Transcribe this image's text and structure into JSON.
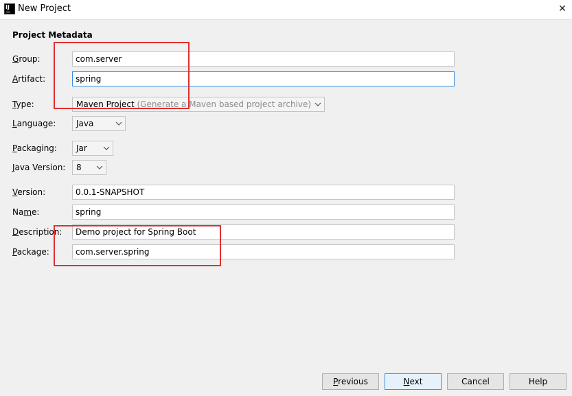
{
  "window": {
    "title": "New Project",
    "close_glyph": "✕"
  },
  "section": {
    "title": "Project Metadata"
  },
  "fields": {
    "group": {
      "mnemonic": "G",
      "rest": "roup:",
      "value": "com.server"
    },
    "artifact": {
      "mnemonic": "A",
      "rest": "rtifact:",
      "value": "spring"
    },
    "type": {
      "mnemonic": "T",
      "rest": "ype:",
      "value": "Maven Project",
      "hint": "(Generate a Maven based project archive)"
    },
    "language": {
      "mnemonic": "L",
      "rest": "anguage:",
      "value": "Java"
    },
    "packaging": {
      "mnemonic": "P",
      "rest": "ackaging:",
      "value": "Jar"
    },
    "java_version": {
      "mnemonic": "J",
      "rest": "ava Version:",
      "value": "8"
    },
    "version": {
      "mnemonic": "V",
      "rest": "ersion:",
      "value": "0.0.1-SNAPSHOT"
    },
    "name": {
      "pre": "Na",
      "mnemonic": "m",
      "rest": "e:",
      "value": "spring"
    },
    "description": {
      "mnemonic": "D",
      "rest": "escription:",
      "value": "Demo project for Spring Boot"
    },
    "package": {
      "mnemonic": "P",
      "rest": "ackage:",
      "value": "com.server.spring"
    }
  },
  "buttons": {
    "previous": {
      "mnemonic": "P",
      "rest": "revious"
    },
    "next": {
      "mnemonic": "N",
      "rest": "ext"
    },
    "cancel": {
      "label": "Cancel"
    },
    "help": {
      "label": "Help"
    }
  },
  "colors": {
    "annotation": "#e03030",
    "focus": "#3d8ede",
    "background": "#f0f0f0"
  }
}
